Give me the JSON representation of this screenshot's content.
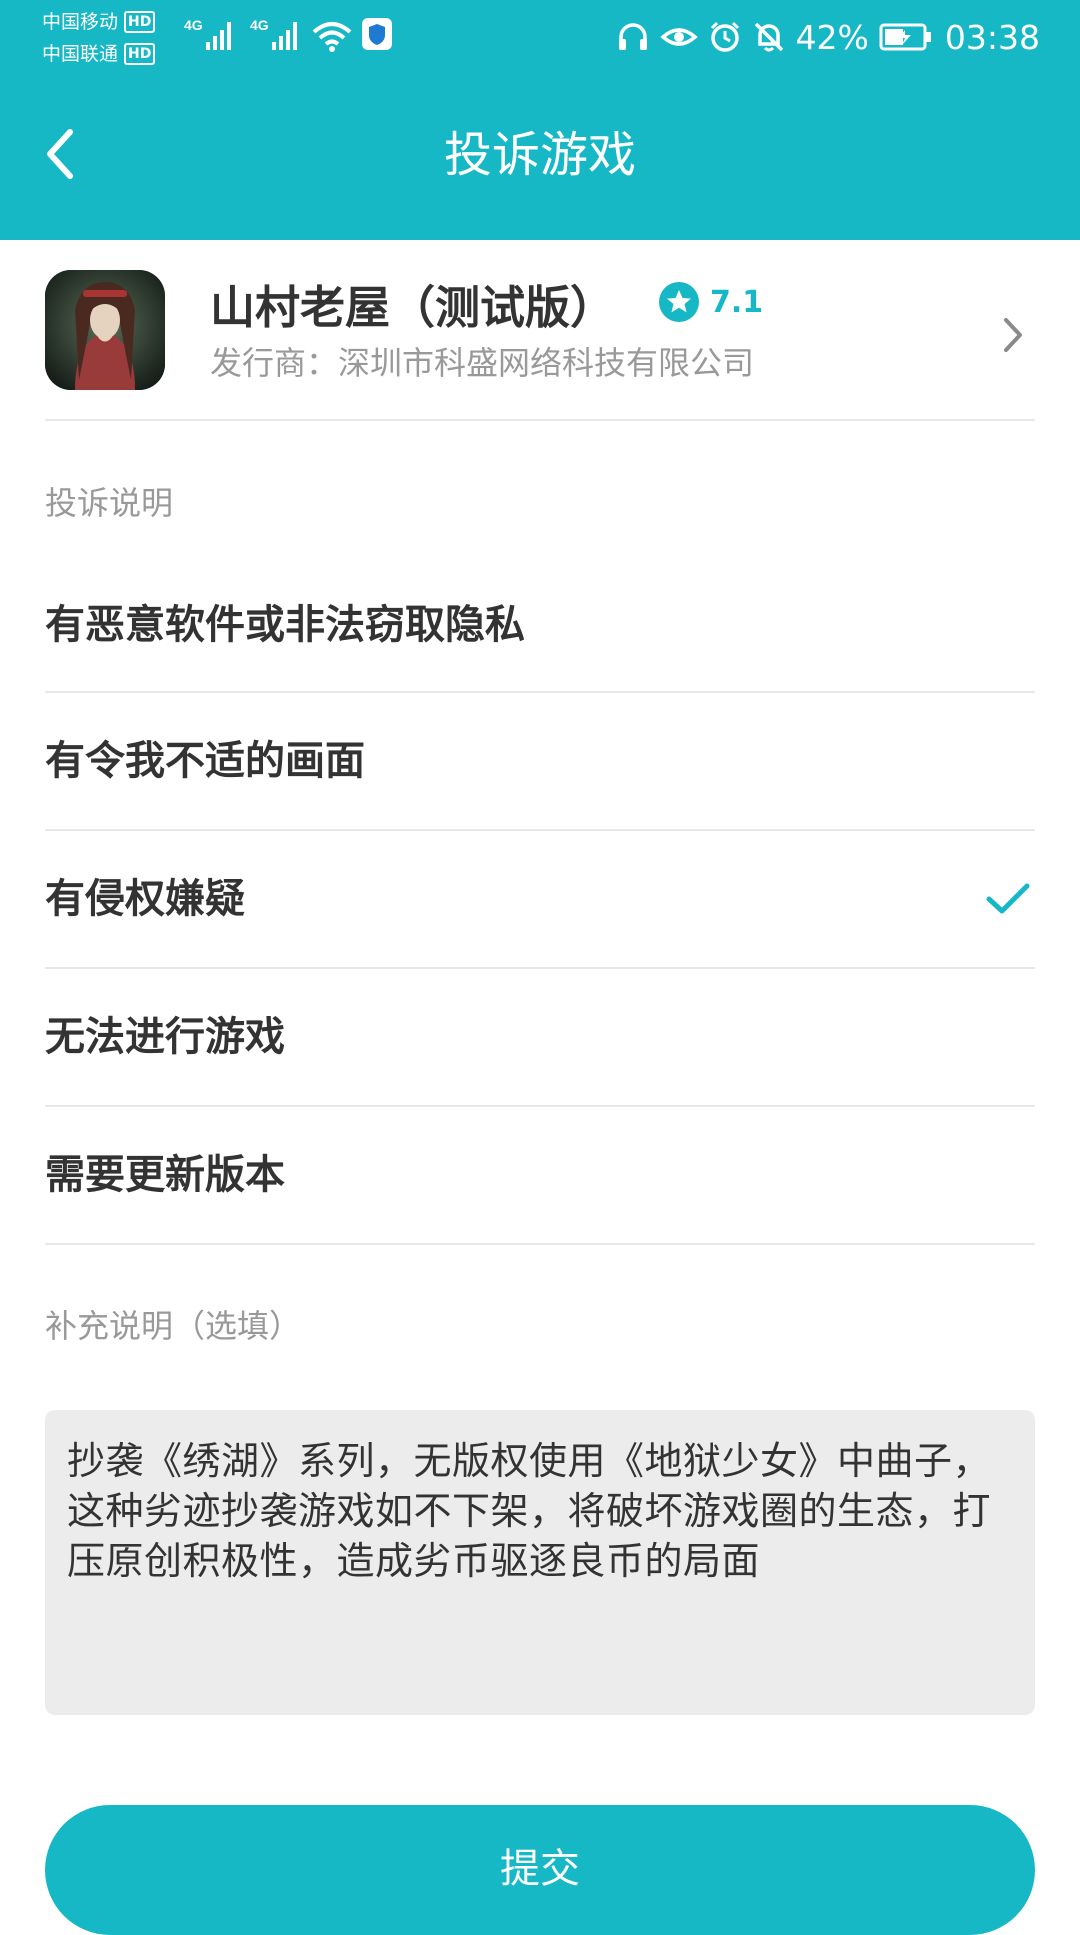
{
  "status_bar": {
    "carrier_1": "中国移动",
    "carrier_2": "中国联通",
    "hd_label": "HD",
    "network_label": "4G",
    "battery": "42%",
    "time": "03:38",
    "icons": [
      "signal-icon",
      "wifi-icon",
      "shield-app-icon",
      "headset-icon",
      "eye-icon",
      "alarm-icon",
      "bell-off-icon",
      "battery-icon"
    ]
  },
  "header": {
    "title": "投诉游戏",
    "back_icon": "chevron-left-icon"
  },
  "game": {
    "name": "山村老屋（测试版）",
    "rating": "7.1",
    "publisher": "发行商：深圳市科盛网络科技有限公司"
  },
  "complaint": {
    "section_label": "投诉说明",
    "options": [
      {
        "label": "有恶意软件或非法窃取隐私",
        "selected": false
      },
      {
        "label": "有令我不适的画面",
        "selected": false
      },
      {
        "label": "有侵权嫌疑",
        "selected": true
      },
      {
        "label": "无法进行游戏",
        "selected": false
      },
      {
        "label": "需要更新版本",
        "selected": false
      }
    ]
  },
  "supplement": {
    "section_label": "补充说明（选填）",
    "text": "抄袭《绣湖》系列，无版权使用《地狱少女》中曲子，这种劣迹抄袭游戏如不下架，将破坏游戏圈的生态，打压原创积极性，造成劣币驱逐良币的局面"
  },
  "submit": {
    "label": "提交"
  },
  "colors": {
    "accent": "#16b8c6",
    "text_primary": "#333333",
    "text_secondary": "#999999",
    "divider": "#e8e8e8",
    "input_bg": "#ececec"
  }
}
